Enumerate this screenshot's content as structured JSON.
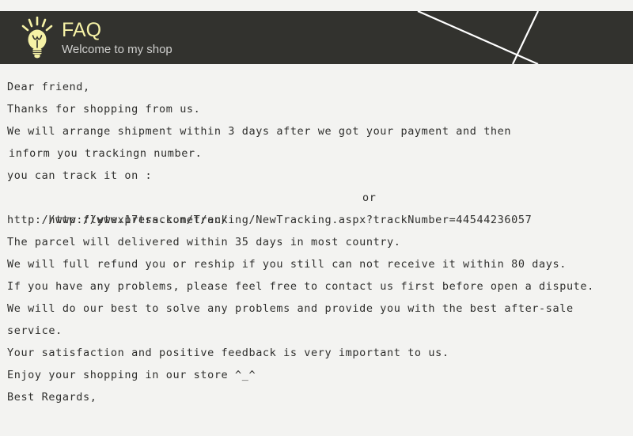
{
  "banner": {
    "icon": "lightbulb-icon",
    "title": "FAQ",
    "subtitle": "Welcome to my shop",
    "title_color": "#f6f2a6",
    "subtitle_color": "#cfcfcd",
    "background_color": "#32322e",
    "decoration": "crossing-diagonal-lines",
    "decoration_color": "#ffffff"
  },
  "page": {
    "background_color": "#f3f3f1",
    "text_color": "#2e2e2c"
  },
  "letter": {
    "lines": [
      "Dear friend,",
      "Thanks for shopping from us.",
      "We will arrange shipment within 3 days after we got your payment and then",
      "inform you trackingn number.",
      "you can track it on :",
      "http://www.17track.net/en/",
      "http://www.flytexpress.com/Tracking/NewTracking.aspx?trackNumber=44544236057",
      "The parcel will delivered within 35 days in most country.",
      "We will full refund you or reship if you still can not receive it within 80 days.",
      "If you have any problems, please feel free to contact us first before open a dispute.",
      "We will do our best to solve any problems and provide you with the best after-sale",
      "service.",
      "Your satisfaction and positive feedback is very important to us.",
      "Enjoy your shopping in our store ^_^",
      "Best Regards,"
    ],
    "or_label": "or",
    "tracking_number": "44544236057"
  }
}
